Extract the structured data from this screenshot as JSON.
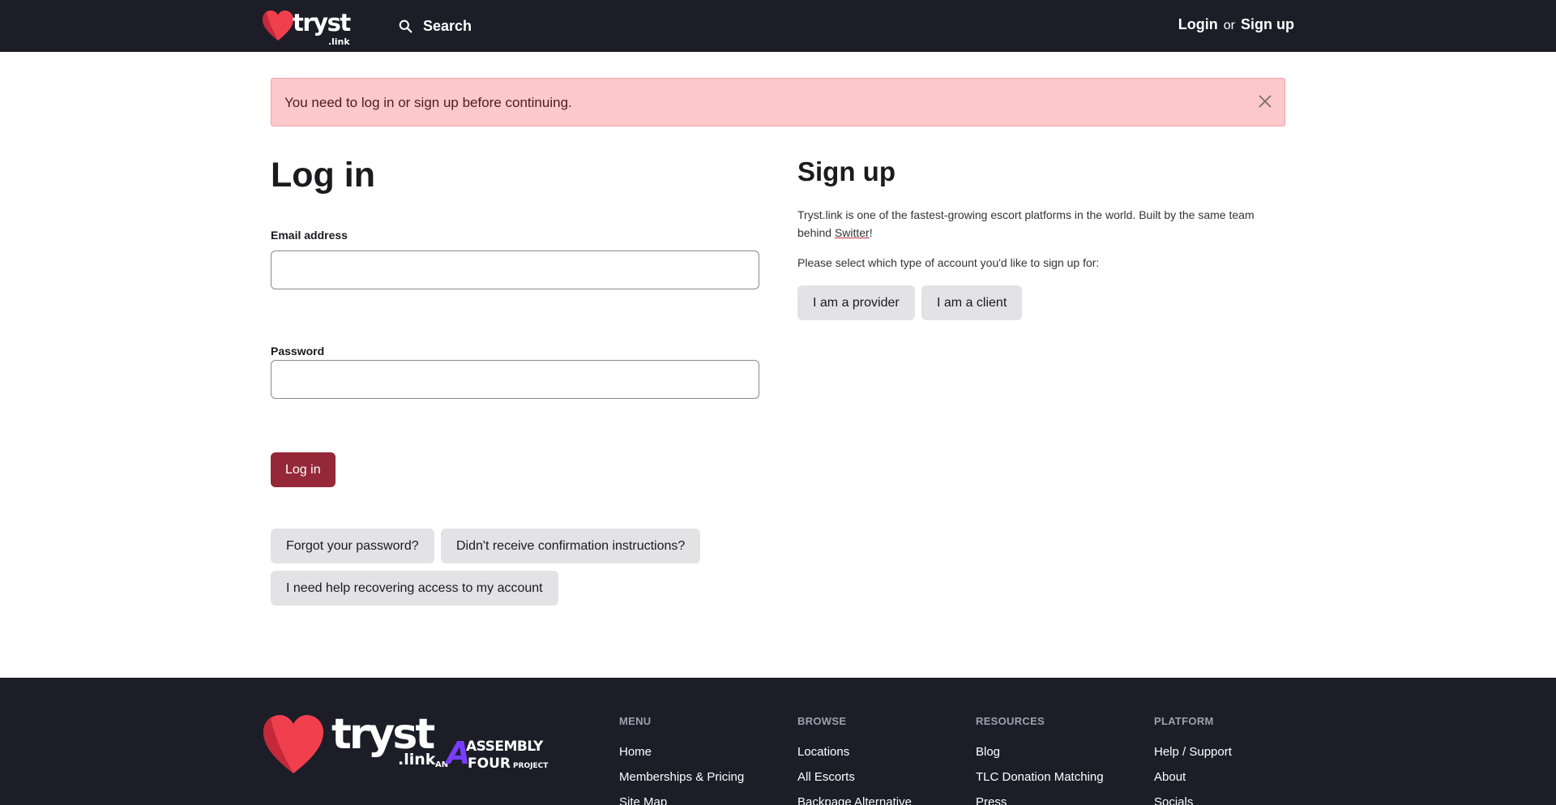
{
  "header": {
    "logo_word": "tryst",
    "logo_sub": ".link",
    "search_label": "Search",
    "login_label": "Login",
    "or_label": "or",
    "signup_label": "Sign up"
  },
  "alert": {
    "message": "You need to log in or sign up before continuing."
  },
  "login": {
    "title": "Log in",
    "email_label": "Email address",
    "email_value": "",
    "password_label": "Password",
    "password_value": "",
    "submit_label": "Log in",
    "forgot_label": "Forgot your password?",
    "confirm_label": "Didn't receive confirmation instructions?",
    "recover_label": "I need help recovering access to my account"
  },
  "signup": {
    "title": "Sign up",
    "desc_before": "Tryst.link is one of the fastest-growing escort platforms in the world. Built by the same team behind ",
    "desc_link": "Switter",
    "desc_after": "!",
    "prompt": "Please select which type of account you'd like to sign up for:",
    "provider_label": "I am a provider",
    "client_label": "I am a client"
  },
  "footer": {
    "logo_word": "tryst",
    "logo_sub": ".link",
    "logo_an": "AN",
    "logo_a4": "A",
    "logo_assembly": "ASSEMBLY",
    "logo_four": "FOUR",
    "logo_project": "PROJECT",
    "columns": [
      {
        "heading": "MENU",
        "links": [
          "Home",
          "Memberships & Pricing",
          "Site Map"
        ]
      },
      {
        "heading": "BROWSE",
        "links": [
          "Locations",
          "All Escorts",
          "Backpage Alternative"
        ]
      },
      {
        "heading": "RESOURCES",
        "links": [
          "Blog",
          "TLC Donation Matching",
          "Press"
        ]
      },
      {
        "heading": "PLATFORM",
        "links": [
          "Help / Support",
          "About",
          "Socials"
        ]
      }
    ]
  },
  "colors": {
    "header_bg": "#1d1d28",
    "brand_red": "#f0404e",
    "primary_button": "#952838",
    "alert_bg": "#fdc8cb",
    "assembly_purple": "#7a3cff"
  }
}
